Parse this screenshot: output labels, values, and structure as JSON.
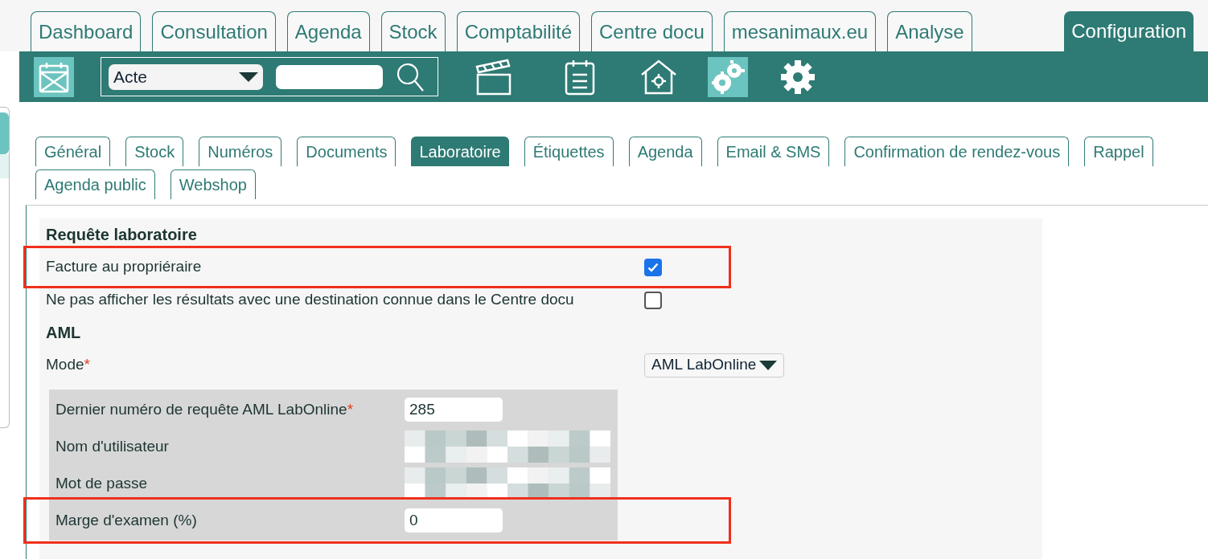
{
  "top_tabs": [
    {
      "label": "Dashboard",
      "selected": false
    },
    {
      "label": "Consultation",
      "selected": false
    },
    {
      "label": "Agenda",
      "selected": false
    },
    {
      "label": "Stock",
      "selected": false
    },
    {
      "label": "Comptabilité",
      "selected": false
    },
    {
      "label": "Centre docu",
      "selected": false
    },
    {
      "label": "mesanimaux.eu",
      "selected": false
    },
    {
      "label": "Analyse",
      "selected": false
    },
    {
      "label": "Configuration",
      "selected": true
    }
  ],
  "toolbar": {
    "search_mode": "Acte"
  },
  "sub_tab_rows": [
    {
      "tabs": [
        {
          "label": "Général",
          "selected": false
        },
        {
          "label": "Stock",
          "selected": false
        },
        {
          "label": "Numéros",
          "selected": false
        },
        {
          "label": "Documents",
          "selected": false
        },
        {
          "label": "Laboratoire",
          "selected": true
        },
        {
          "label": "Étiquettes",
          "selected": false
        },
        {
          "label": "Agenda",
          "selected": false
        },
        {
          "label": "Email & SMS",
          "selected": false
        },
        {
          "label": "Confirmation de rendez-vous",
          "selected": false
        },
        {
          "label": "Rappel",
          "selected": false
        }
      ]
    },
    {
      "tabs": [
        {
          "label": "Agenda public",
          "selected": false
        },
        {
          "label": "Webshop",
          "selected": false
        }
      ]
    }
  ],
  "sections": [
    {
      "heading": "Requête laboratoire",
      "rows": [
        {
          "kind": "checkbox",
          "label": "Facture au propriéraire",
          "checked": true,
          "highlighted": true
        },
        {
          "kind": "checkbox",
          "label": "Ne pas afficher les résultats avec une destination connue dans le Centre docu",
          "checked": false,
          "highlighted": false
        }
      ]
    },
    {
      "heading": "AML",
      "rows": [
        {
          "kind": "select",
          "label": "Mode",
          "required_mark": "*",
          "value": "AML LabOnline",
          "highlighted": false
        }
      ],
      "subpanel": [
        {
          "kind": "text",
          "label": "Dernier numéro de requête AML LabOnline",
          "required_mark": "*",
          "value": "285",
          "highlighted": false
        },
        {
          "kind": "blurred",
          "label": "Nom d'utilisateur",
          "highlighted": false
        },
        {
          "kind": "blurred",
          "label": "Mot de passe",
          "highlighted": false
        },
        {
          "kind": "text",
          "label": "Marge d'examen (%)",
          "value": "0",
          "highlighted": true
        }
      ]
    }
  ]
}
